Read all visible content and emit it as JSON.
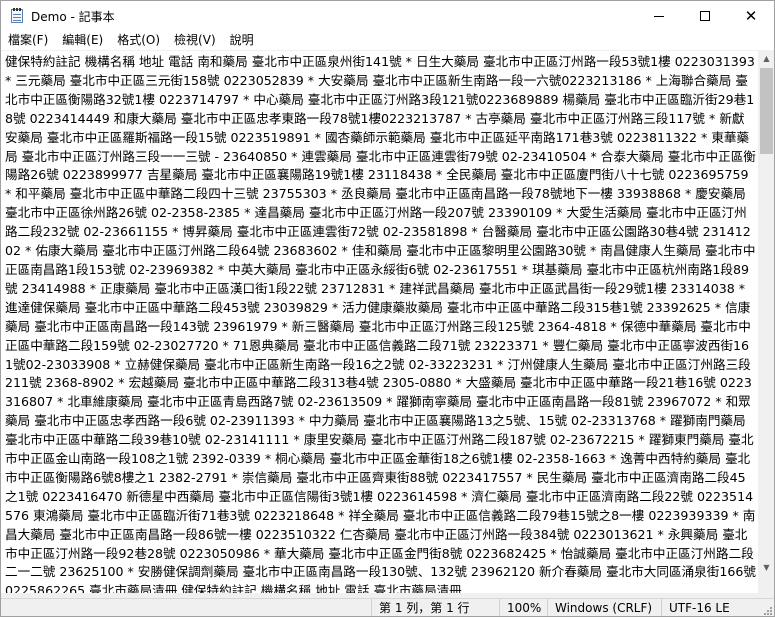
{
  "window": {
    "title": "Demo - 記事本"
  },
  "menu": {
    "items": [
      {
        "label": "檔案(F)"
      },
      {
        "label": "編輯(E)"
      },
      {
        "label": "格式(O)"
      },
      {
        "label": "檢視(V)"
      },
      {
        "label": "說明"
      }
    ]
  },
  "document": {
    "text": "健保特約註記 機構名稱 地址 電話 南和藥局 臺北市中正區泉州街141號 * 日生大藥局 臺北市中正區汀州路一段53號1樓 0223031393 * 三元藥局 臺北市中正區三元街158號 0223052839 * 大安藥局 臺北市中正區新生南路一段一六號0223213186 * 上海聯合藥局 臺北市中正區衡陽路32號1樓 0223714797 * 中心藥局 臺北市中正區汀州路3段121號0223689889 楊藥局 臺北市中正區臨沂街29巷18號 0223414449 和康大藥局 臺北市中正區忠孝東路一段78號1樓0223213787 * 古亭藥局 臺北市中正區汀州路三段117號 * 新獻安藥局 臺北市中正區羅斯福路一段15號 0223519891 * 國杏藥師示範藥局 臺北市中正區延平南路171巷3號 0223811322 * 東華藥局 臺北市中正區汀州路三段一一三號 - 23640850 * 連雲藥局 臺北市中正區連雲街79號 02-23410504 * 合泰大藥局 臺北市中正區衡陽路26號 0223899977 吉星藥局 臺北市中正區襄陽路19號1樓 23118438 * 全民藥局 臺北市中正區廈門街八十七號 0223695759 * 和平藥局 臺北市中正區中華路二段四十三號 23755303 * 丞良藥局 臺北市中正區南昌路一段78號地下一樓 33938868 * 慶安藥局 臺北市中正區徐州路26號 02-2358-2385 * 達昌藥局 臺北市中正區汀州路一段207號 23390109 * 大愛生活藥局 臺北市中正區汀州路二段232號 02-23661155 * 博昇藥局 臺北市中正區連雲街72號 02-23581898 * 台醫藥局 臺北市中正區公園路30巷4號 23141202 * 佑康大藥局 臺北市中正區汀州路二段64號 23683602 * 佳和藥局 臺北市中正區黎明里公園路30號 * 南昌健康人生藥局 臺北市中正區南昌路1段153號 02-23969382 * 中英大藥局 臺北市中正區永綏街6號 02-23617551 * 琪基藥局 臺北市中正區杭州南路1段89號 23414988 * 正康藥局 臺北市中正區漢口街1段22號 23712831 * 建祥武昌藥局 臺北市中正區武昌街一段29號1樓 23314038 * 進達健保藥局 臺北市中正區中華路二段453號 23039829 * 活力健康藥妝藥局 臺北市中正區中華路二段315巷1號 23392625 * 信康藥局 臺北市中正區南昌路一段143號 23961979 * 新三醫藥局 臺北市中正區汀州路三段125號 2364-4818 * 保德中華藥局 臺北市中正區中華路二段159號 02-23027720 * 71恩典藥局 臺北市中正區信義路二段71號 23223371 * 豐仁藥局 臺北市中正區寧波西街161號02-23033908 * 立赫健保藥局 臺北市中正區新生南路一段16之2號 02-33223231 * 汀州健康人生藥局 臺北市中正區汀州路三段211號 2368-8902 * 宏越藥局 臺北市中正區中華路二段313巷4號 2305-0880 * 大盛藥局 臺北市中正區中華路一段21巷16號 0223316807 * 北車維康藥局 臺北市中正區青島西路7號 02-23613509 * 躍獅南寧藥局 臺北市中正區南昌路一段81號 23967072 * 和眾藥局 臺北市中正區忠孝西路一段6號 02-23911393 * 中力藥局 臺北市中正區襄陽路13之5號、15號 02-23313768 * 躍獅南門藥局 臺北市中正區中華路二段39巷10號 02-23141111 * 康里安藥局 臺北市中正區汀州路二段187號 02-23672215 * 躍獅東門藥局 臺北市中正區金山南路一段108之1號 2392-0339 * 桐心藥局 臺北市中正區金華街18之6號1樓 02-2358-1663 * 逸菁中西特約藥局 臺北市中正區衡陽路6號8樓之1 2382-2791 * 崇信藥局 臺北市中正區齊東街88號 0223417557 * 民生藥局 臺北市中正區濟南路二段45之1號 0223416470 新德星中西藥局 臺北市中正區信陽街3號1樓 0223614598 * 濟仁藥局 臺北市中正區濟南路二段22號 0223514576 東鴻藥局 臺北市中正區臨沂街71巷3號 0223218648 * 祥全藥局 臺北市中正區信義路二段79巷15號之8一樓 0223939339 * 南昌大藥局 臺北市中正區南昌路一段86號一樓 0223510322 仁杏藥局 臺北市中正區汀州路一段384號 0223013621 * 永興藥局 臺北市中正區汀州路一段92巷28號 0223050986 * 華大藥局 臺北市中正區金門街8號 0223682425 * 怡誠藥局 臺北市中正區汀州路二段二一二號 23625100 * 安勝健保調劑藥局 臺北市中正區南昌路一段130號、132號 23962120 新介春藥局 臺北市大同區涌泉街166號 0225862265 臺北市藥局清冊 健保特約註記 機構名稱 地址 電話 臺北市藥局清冊"
  },
  "status": {
    "position": "第 1 列，第 1 行",
    "zoom": "100%",
    "line_ending": "Windows (CRLF)",
    "encoding": "UTF-16 LE"
  }
}
